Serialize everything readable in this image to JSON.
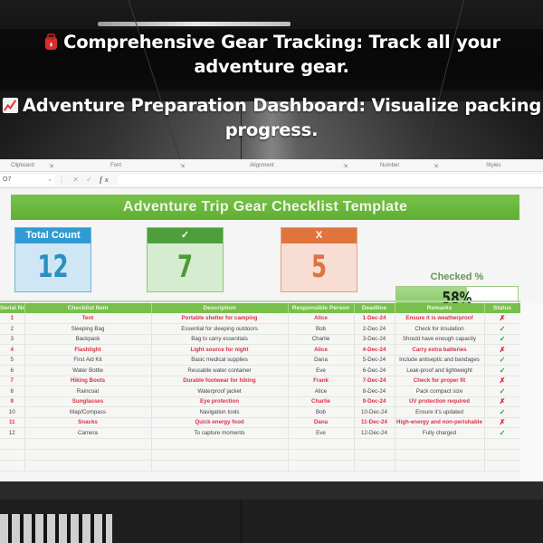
{
  "promo": {
    "line1": {
      "icon": "backpack-icon",
      "text": "Comprehensive Gear Tracking: Track all your adventure gear."
    },
    "line2": {
      "icon": "chart-increasing-icon",
      "text": "Adventure Preparation Dashboard: Visualize packing progress."
    }
  },
  "ribbon": {
    "groups": [
      "Clipboard",
      "Font",
      "Alignment",
      "Number",
      "Styles"
    ],
    "launcher_icon": "dialog-launcher-icon"
  },
  "formula_bar": {
    "name_box": "O7",
    "cancel_icon": "✕",
    "enter_icon": "✓",
    "fx_label": "fx",
    "value": ""
  },
  "sheet": {
    "title": "Adventure Trip Gear Checklist Template",
    "cards": {
      "total": {
        "label": "Total Count",
        "value": "12"
      },
      "checked": {
        "label": "✓",
        "value": "7"
      },
      "unchecked": {
        "label": "X",
        "value": "5"
      }
    },
    "checked_percent": {
      "label": "Checked %",
      "value": 0.58,
      "display": "58%"
    },
    "colors": {
      "banner": "#6bb83e",
      "total": "#2f9bd2",
      "checked": "#4e9e3b",
      "unchecked": "#e0743d",
      "alert_text": "#dc2f47"
    },
    "table": {
      "headers": [
        "Serial No.",
        "Checklist Item",
        "Description",
        "Responsible Person",
        "Deadline",
        "Remarks",
        "Status"
      ],
      "rows": [
        {
          "serial": "1",
          "item": "Tent",
          "description": "Portable shelter for camping",
          "person": "Alice",
          "deadline": "1-Dec-24",
          "remarks": "Ensure it is weatherproof",
          "status": "✗",
          "checked": false
        },
        {
          "serial": "2",
          "item": "Sleeping Bag",
          "description": "Essential for sleeping outdoors",
          "person": "Bob",
          "deadline": "2-Dec-24",
          "remarks": "Check for insulation",
          "status": "✓",
          "checked": true
        },
        {
          "serial": "3",
          "item": "Backpack",
          "description": "Bag to carry essentials",
          "person": "Charlie",
          "deadline": "3-Dec-24",
          "remarks": "Should have enough capacity",
          "status": "✓",
          "checked": true
        },
        {
          "serial": "4",
          "item": "Flashlight",
          "description": "Light source for night",
          "person": "Alice",
          "deadline": "4-Dec-24",
          "remarks": "Carry extra batteries",
          "status": "✗",
          "checked": false
        },
        {
          "serial": "5",
          "item": "First Aid Kit",
          "description": "Basic medical supplies",
          "person": "Dana",
          "deadline": "5-Dec-24",
          "remarks": "Include antiseptic and bandages",
          "status": "✓",
          "checked": true
        },
        {
          "serial": "6",
          "item": "Water Bottle",
          "description": "Reusable water container",
          "person": "Eve",
          "deadline": "6-Dec-24",
          "remarks": "Leak-proof and lightweight",
          "status": "✓",
          "checked": true
        },
        {
          "serial": "7",
          "item": "Hiking Boots",
          "description": "Durable footwear for hiking",
          "person": "Frank",
          "deadline": "7-Dec-24",
          "remarks": "Check for proper fit",
          "status": "✗",
          "checked": false
        },
        {
          "serial": "8",
          "item": "Raincoat",
          "description": "Waterproof jacket",
          "person": "Alice",
          "deadline": "8-Dec-24",
          "remarks": "Pack compact size",
          "status": "✓",
          "checked": true
        },
        {
          "serial": "9",
          "item": "Sunglasses",
          "description": "Eye protection",
          "person": "Charlie",
          "deadline": "9-Dec-24",
          "remarks": "UV protection required",
          "status": "✗",
          "checked": false
        },
        {
          "serial": "10",
          "item": "Map/Compass",
          "description": "Navigation tools",
          "person": "Bob",
          "deadline": "10-Dec-24",
          "remarks": "Ensure it's updated",
          "status": "✓",
          "checked": true
        },
        {
          "serial": "11",
          "item": "Snacks",
          "description": "Quick energy food",
          "person": "Dana",
          "deadline": "11-Dec-24",
          "remarks": "High-energy and non-perishable",
          "status": "✗",
          "checked": false
        },
        {
          "serial": "12",
          "item": "Camera",
          "description": "To capture moments",
          "person": "Eve",
          "deadline": "12-Dec-24",
          "remarks": "Fully charged",
          "status": "✓",
          "checked": true
        }
      ]
    }
  }
}
